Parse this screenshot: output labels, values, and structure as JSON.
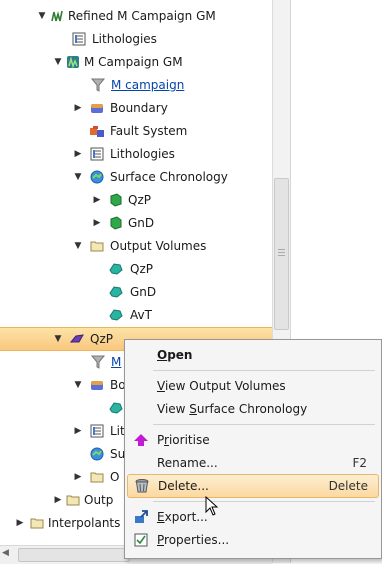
{
  "tree": {
    "items": [
      {
        "label": "Refined M Campaign GM",
        "expander": "▼",
        "icon": "refined-model-icon"
      },
      {
        "label": "Lithologies",
        "expander": "",
        "icon": "lithologies-icon"
      },
      {
        "label": "M Campaign GM",
        "expander": "▼",
        "icon": "geological-model-icon"
      },
      {
        "label": "M campaign",
        "expander": "",
        "icon": "filter-icon",
        "link": true
      },
      {
        "label": "Boundary",
        "expander": "▶",
        "icon": "boundary-icon"
      },
      {
        "label": "Fault System",
        "expander": "",
        "icon": "fault-system-icon"
      },
      {
        "label": "Lithologies",
        "expander": "▶",
        "icon": "lithologies-icon"
      },
      {
        "label": "Surface Chronology",
        "expander": "▼",
        "icon": "surface-chronology-icon"
      },
      {
        "label": "QzP",
        "expander": "▶",
        "icon": "green-volume-icon"
      },
      {
        "label": "GnD",
        "expander": "▶",
        "icon": "green-volume-icon"
      },
      {
        "label": "Output Volumes",
        "expander": "▼",
        "icon": "folder-icon"
      },
      {
        "label": "QzP",
        "expander": "",
        "icon": "teal-volume-icon"
      },
      {
        "label": "GnD",
        "expander": "",
        "icon": "teal-volume-icon"
      },
      {
        "label": "AvT",
        "expander": "",
        "icon": "teal-volume-icon"
      },
      {
        "label": "QzP",
        "expander": "▼",
        "icon": "purple-surface-icon",
        "selected": true
      },
      {
        "label": "M",
        "expander": "",
        "icon": "filter-icon",
        "link": true
      },
      {
        "label": "Bo",
        "expander": "▼",
        "icon": "boundary-icon"
      },
      {
        "label": "",
        "expander": "",
        "icon": "teal-volume-icon"
      },
      {
        "label": "Lit",
        "expander": "▶",
        "icon": "lithologies-icon"
      },
      {
        "label": "Su",
        "expander": "",
        "icon": "surface-chronology-icon"
      },
      {
        "label": "O",
        "expander": "▶",
        "icon": "folder-icon"
      },
      {
        "label": "Outp",
        "expander": "▶",
        "icon": "folder-icon"
      },
      {
        "label": "Interpolants",
        "expander": "▶",
        "icon": "folder-icon"
      }
    ]
  },
  "context_menu": {
    "items": [
      {
        "label": "Open",
        "mnemonic": "O",
        "bold": true
      },
      {
        "label": "View Output Volumes",
        "mnemonic": "V"
      },
      {
        "label": "View Surface Chronology",
        "mnemonic": "S"
      },
      {
        "label": "Prioritise",
        "mnemonic": "r",
        "icon": "up-arrow-icon"
      },
      {
        "label": "Rename...",
        "shortcut": "F2"
      },
      {
        "label": "Delete...",
        "shortcut": "Delete",
        "icon": "trash-icon",
        "highlighted": true
      },
      {
        "label": "Export...",
        "mnemonic": "E",
        "icon": "export-icon"
      },
      {
        "label": "Properties...",
        "mnemonic": "P",
        "icon": "properties-icon"
      }
    ]
  },
  "colors": {
    "selection": "#f8c77e",
    "highlight": "#fcd9a0",
    "link": "#0645ad",
    "prioritise_arrow": "#c21bd6"
  }
}
